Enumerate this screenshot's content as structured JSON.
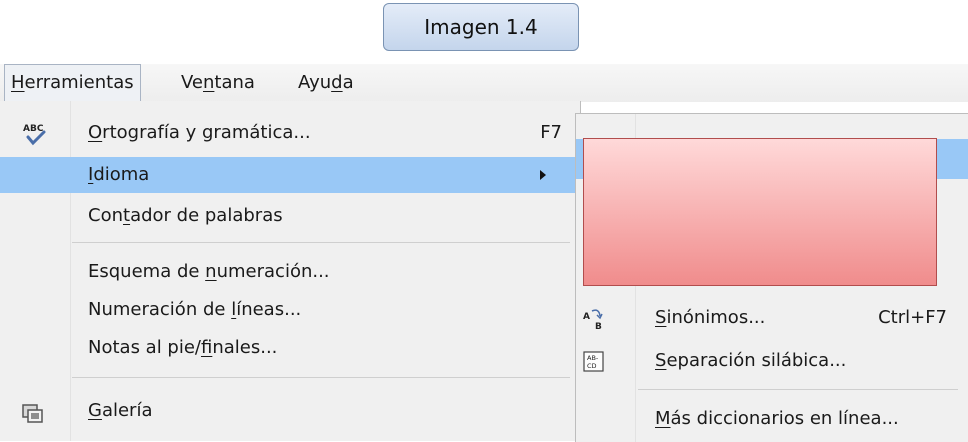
{
  "caption": "Imagen 1.4",
  "menubar": {
    "items": [
      {
        "pre": "",
        "u": "H",
        "post": "erramientas"
      },
      {
        "pre": "Ve",
        "u": "n",
        "post": "tana"
      },
      {
        "pre": "Ayu",
        "u": "d",
        "post": "a"
      }
    ]
  },
  "menu": {
    "items": [
      {
        "pre": "",
        "u": "O",
        "post": "rtografía y gramática...",
        "shortcut": "F7",
        "icon": "spellcheck-icon"
      },
      {
        "pre": "",
        "u": "I",
        "post": "dioma",
        "submenu": true
      },
      {
        "pre": "Con",
        "u": "t",
        "post": "ador de palabras"
      },
      {
        "pre": "Esquema de ",
        "u": "n",
        "post": "umeración..."
      },
      {
        "pre": "Numeración de ",
        "u": "l",
        "post": "íneas..."
      },
      {
        "pre": "Notas al pie/",
        "u": "f",
        "post": "inales..."
      },
      {
        "pre": "",
        "u": "G",
        "post": "alería",
        "icon": "gallery-icon"
      }
    ]
  },
  "submenu": {
    "items": [
      {
        "pre": "",
        "u": "S",
        "post": "inónimos...",
        "shortcut": "Ctrl+F7",
        "icon": "thesaurus-icon"
      },
      {
        "pre": "",
        "u": "S",
        "post": "eparación silábica...",
        "icon": "hyphenation-icon"
      },
      {
        "pre": "",
        "u": "M",
        "post": "ás diccionarios en línea..."
      }
    ]
  },
  "colors": {
    "highlight": "#99c8f6",
    "menu_bg": "#f0f0f0",
    "redbox_top": "#ffd9d9",
    "redbox_bottom": "#f08c8c"
  }
}
